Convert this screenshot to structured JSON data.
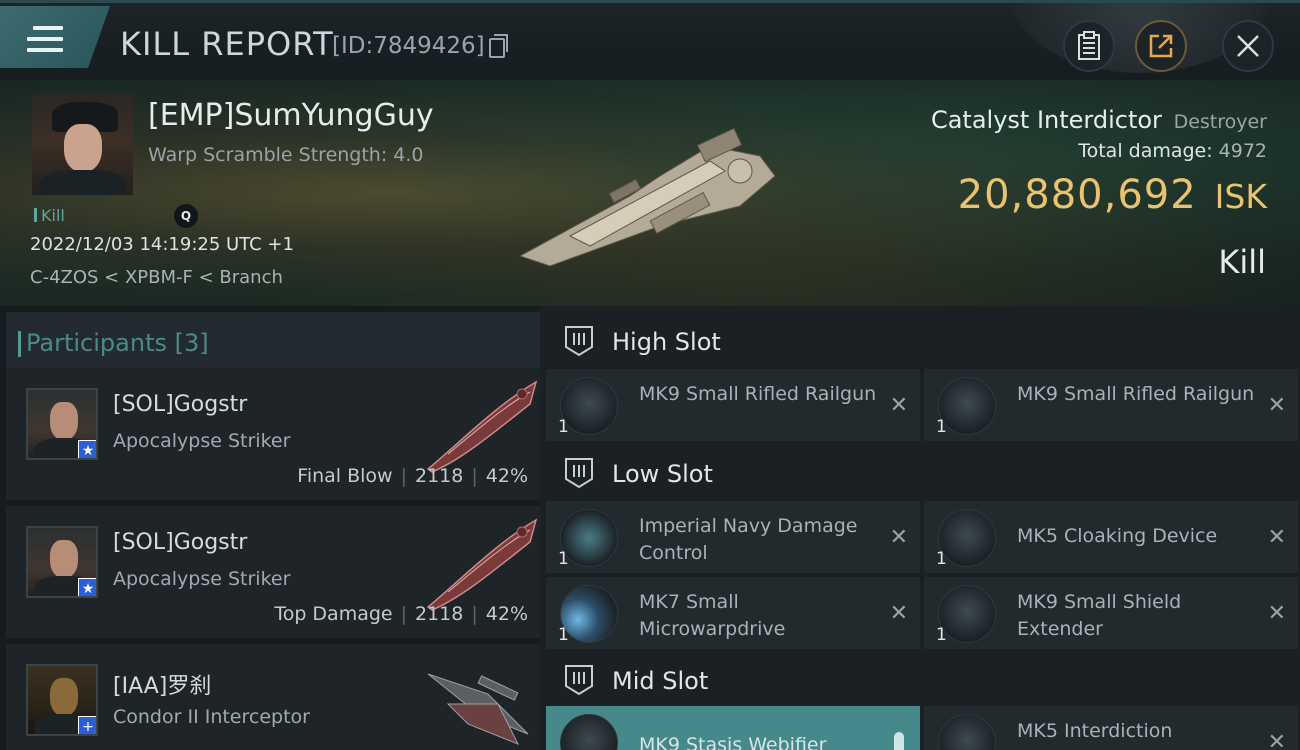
{
  "header": {
    "title": "KILL REPORT",
    "report_id": "[ID:7849426]",
    "icons": [
      "menu-icon",
      "copy-icon",
      "clipboard-icon",
      "share-icon",
      "close-icon"
    ]
  },
  "victim": {
    "name": "[EMP]SumYungGuy",
    "subtitle": "Warp Scramble Strength: 4.0",
    "kill_tag": "Kill",
    "q_badge": "Q",
    "datetime": "2022/12/03 14:19:25 UTC +1",
    "location": "C-4ZOS < XPBM-F < Branch",
    "ship_name": "Catalyst Interdictor",
    "ship_class": "Destroyer",
    "total_damage_label": "Total damage:",
    "total_damage_value": "4972",
    "isk_value": "20,880,692",
    "isk_unit": "ISK",
    "result": "Kill"
  },
  "participants": {
    "header": "Participants [3]",
    "list": [
      {
        "name": "[SOL]Gogstr",
        "ship": "Apocalypse Striker",
        "role": "Final Blow",
        "damage": "2118",
        "percent": "42%",
        "badge": "★",
        "badge_color": "#2a5fd6"
      },
      {
        "name": "[SOL]Gogstr",
        "ship": "Apocalypse Striker",
        "role": "Top Damage",
        "damage": "2118",
        "percent": "42%",
        "badge": "★",
        "badge_color": "#2a5fd6"
      },
      {
        "name": "[IAA]罗刹",
        "ship": "Condor II Interceptor",
        "badge": "+",
        "badge_color": "#2a5fd6"
      }
    ]
  },
  "fitting": {
    "high_slot": {
      "label": "High Slot",
      "modules": [
        {
          "qty": "1",
          "name": "MK9 Small Rifled Railgun"
        },
        {
          "qty": "1",
          "name": "MK9 Small Rifled Railgun"
        }
      ]
    },
    "low_slot": {
      "label": "Low Slot",
      "modules": [
        {
          "qty": "1",
          "name": "Imperial Navy Damage Control"
        },
        {
          "qty": "1",
          "name": "MK5 Cloaking Device"
        },
        {
          "qty": "1",
          "name": "MK7 Small Microwarpdrive"
        },
        {
          "qty": "1",
          "name": "MK9 Small Shield Extender"
        }
      ]
    },
    "mid_slot": {
      "label": "Mid Slot",
      "modules": [
        {
          "qty": "",
          "name": "MK9 Stasis Webifier",
          "highlighted": true
        },
        {
          "qty": "",
          "name": "MK5 Interdiction"
        }
      ]
    },
    "remove_symbol": "✕"
  },
  "colors": {
    "accent": "#4c8a88",
    "isk": "#e9c36f",
    "highlight": "#46898a"
  }
}
